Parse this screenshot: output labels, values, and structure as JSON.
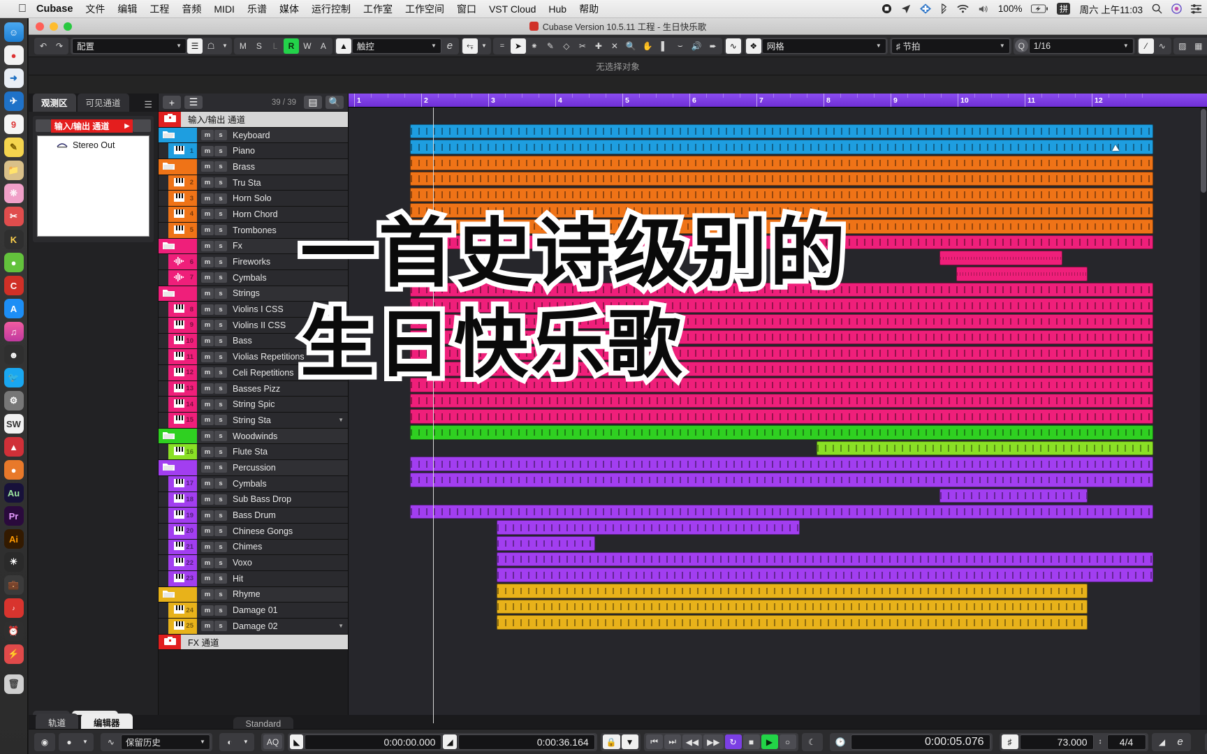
{
  "macbar": {
    "apple_icon": "apple-logo",
    "app": "Cubase",
    "menus": [
      "文件",
      "编辑",
      "工程",
      "音频",
      "MIDI",
      "乐谱",
      "媒体",
      "运行控制",
      "工作室",
      "工作空间",
      "窗口",
      "VST Cloud",
      "Hub",
      "帮助"
    ],
    "status": {
      "record_icon": "screen-record-icon",
      "location_icon": "location-arrow-icon",
      "app_icon": "diamond-app-icon",
      "bluetooth_icon": "bluetooth-icon",
      "wifi_icon": "wifi-icon",
      "volume_icon": "speaker-icon",
      "battery_percent": "100%",
      "battery_icon": "battery-charging-icon",
      "input_source": "拼",
      "clock": "周六 上午11:03",
      "spotlight_icon": "search-icon",
      "siri_icon": "siri-icon",
      "controlcenter_icon": "control-center-icon"
    }
  },
  "window": {
    "title": "Cubase Version 10.5.11 工程 - 生日快乐歌",
    "doc_icon": "cubase-doc-icon"
  },
  "toolbar": {
    "undo_icon": "undo-icon",
    "redo_icon": "redo-icon",
    "config_value": "配置",
    "list_icon": "list-icon",
    "home_icon": "constrain-icon",
    "mute": "M",
    "solo": "S",
    "listen": "L",
    "read": "R",
    "write": "W",
    "auto": "A",
    "autoscroll_icon": "autoscroll-icon",
    "touch_value": "触控",
    "e_icon": "e-icon",
    "snap_align_icon": "snap-align-icon",
    "tools": [
      "equal-icon",
      "arrow-select-icon",
      "range-select-icon",
      "draw-pencil-icon",
      "erase-icon",
      "scissors-icon",
      "glue-icon",
      "mute-x-icon",
      "zoom-magnifier-icon",
      "hand-icon",
      "comp-icon",
      "warp-icon",
      "play-speaker-icon",
      "color-icon"
    ],
    "snap_icon": "snap-magnet-icon",
    "snap_cross_icon": "snap-cross-icon",
    "grid_value": "网格",
    "grid_type_icon": "grid-type-icon",
    "beat_value": "节拍",
    "q_icon": "quantize-icon",
    "quantize_value": "1/16",
    "extra_icons": [
      "percent-icon",
      "waveform-icon",
      "left-zone-icon",
      "lower-zone-icon",
      "right-zone-icon",
      "window-layout-icon",
      "setup-gear-icon"
    ]
  },
  "infobar": {
    "text": "无选择对象"
  },
  "left_zone": {
    "tabs": [
      {
        "label": "观测区",
        "active": true
      },
      {
        "label": "可见通道",
        "active": false
      }
    ],
    "hamburger_icon": "hamburger-icon",
    "io_header": "输入/输出 通道",
    "io_arrow_icon": "chevron-right-icon",
    "io_items": [
      {
        "label": "Stereo Out",
        "icon": "stereo-out-icon"
      }
    ],
    "bottom_tabs": [
      {
        "label": "轨道",
        "active": false
      },
      {
        "label": "编辑器",
        "active": true
      }
    ]
  },
  "track_list": {
    "add_icon": "add-track-icon",
    "filter_icon": "track-filter-icon",
    "count": "39 / 39",
    "list_icon": "list-view-icon",
    "search_icon": "search-icon",
    "footer_preset": "Standard",
    "footer_gear_icon": "gear-icon",
    "mute_label": "m",
    "solo_label": "s",
    "tracks": [
      {
        "name": "输入/输出 通道",
        "type": "io",
        "color": "#e01f1f",
        "num": "",
        "icon": "folder-icon"
      },
      {
        "name": "Keyboard",
        "type": "folder",
        "color": "#1e9ee0",
        "num": "",
        "icon": "folder-icon"
      },
      {
        "name": "Piano",
        "type": "instrument",
        "color": "#1e9ee0",
        "num": "1",
        "icon": "keys-icon"
      },
      {
        "name": "Brass",
        "type": "folder",
        "color": "#ef7317",
        "num": "",
        "icon": "folder-icon"
      },
      {
        "name": "Tru Sta",
        "type": "instrument",
        "color": "#ef7317",
        "num": "2",
        "icon": "keys-icon"
      },
      {
        "name": "Horn Solo",
        "type": "instrument",
        "color": "#ef7317",
        "num": "3",
        "icon": "keys-icon"
      },
      {
        "name": "Horn Chord",
        "type": "instrument",
        "color": "#ef7317",
        "num": "4",
        "icon": "keys-icon"
      },
      {
        "name": "Trombones",
        "type": "instrument",
        "color": "#ef7317",
        "num": "5",
        "icon": "keys-icon"
      },
      {
        "name": "Fx",
        "type": "folder",
        "color": "#ef1f7a",
        "num": "",
        "icon": "folder-icon"
      },
      {
        "name": "Fireworks",
        "type": "audio",
        "color": "#ef1f7a",
        "num": "6",
        "icon": "wave-icon"
      },
      {
        "name": "Cymbals",
        "type": "audio",
        "color": "#ef1f7a",
        "num": "7",
        "icon": "wave-icon"
      },
      {
        "name": "Strings",
        "type": "folder",
        "color": "#ef1f7a",
        "num": "",
        "icon": "folder-icon"
      },
      {
        "name": "Violins I CSS",
        "type": "instrument",
        "color": "#ef1f7a",
        "num": "8",
        "icon": "keys-icon"
      },
      {
        "name": "Violins II CSS",
        "type": "instrument",
        "color": "#ef1f7a",
        "num": "9",
        "icon": "keys-icon"
      },
      {
        "name": "Bass",
        "type": "instrument",
        "color": "#ef1f7a",
        "num": "10",
        "icon": "keys-icon"
      },
      {
        "name": "Violias Repetitions",
        "type": "instrument",
        "color": "#ef1f7a",
        "num": "11",
        "icon": "keys-icon"
      },
      {
        "name": "Celi Repetitions",
        "type": "instrument",
        "color": "#ef1f7a",
        "num": "12",
        "icon": "keys-icon"
      },
      {
        "name": "Basses Pizz",
        "type": "instrument",
        "color": "#ef1f7a",
        "num": "13",
        "icon": "keys-icon"
      },
      {
        "name": "String Spic",
        "type": "instrument",
        "color": "#ef1f7a",
        "num": "14",
        "icon": "keys-icon"
      },
      {
        "name": "String Sta",
        "type": "instrument",
        "color": "#ef1f7a",
        "num": "15",
        "icon": "keys-icon"
      },
      {
        "name": "Woodwinds",
        "type": "folder",
        "color": "#2fd021",
        "num": "",
        "icon": "folder-icon"
      },
      {
        "name": "Flute Sta",
        "type": "instrument",
        "color": "#8ae025",
        "num": "16",
        "icon": "keys-icon"
      },
      {
        "name": "Percussion",
        "type": "folder",
        "color": "#a23ef0",
        "num": "",
        "icon": "folder-icon"
      },
      {
        "name": "Cymbals",
        "type": "instrument",
        "color": "#a23ef0",
        "num": "17",
        "icon": "keys-icon"
      },
      {
        "name": "Sub Bass Drop",
        "type": "instrument",
        "color": "#a23ef0",
        "num": "18",
        "icon": "keys-icon"
      },
      {
        "name": "Bass Drum",
        "type": "instrument",
        "color": "#a23ef0",
        "num": "19",
        "icon": "keys-icon"
      },
      {
        "name": "Chinese Gongs",
        "type": "instrument",
        "color": "#a23ef0",
        "num": "20",
        "icon": "keys-icon"
      },
      {
        "name": "Chimes",
        "type": "instrument",
        "color": "#a23ef0",
        "num": "21",
        "icon": "keys-icon"
      },
      {
        "name": "Voxo",
        "type": "instrument",
        "color": "#a23ef0",
        "num": "22",
        "icon": "keys-icon"
      },
      {
        "name": "Hit",
        "type": "instrument",
        "color": "#a23ef0",
        "num": "23",
        "icon": "keys-icon"
      },
      {
        "name": "Rhyme",
        "type": "folder",
        "color": "#e8b21a",
        "num": "",
        "icon": "folder-icon"
      },
      {
        "name": "Damage 01",
        "type": "instrument",
        "color": "#e8b21a",
        "num": "24",
        "icon": "keys-icon"
      },
      {
        "name": "Damage 02",
        "type": "instrument",
        "color": "#e8b21a",
        "num": "25",
        "icon": "keys-icon"
      },
      {
        "name": "FX 通道",
        "type": "io",
        "color": "#e01f1f",
        "num": "",
        "icon": "folder-icon"
      }
    ]
  },
  "arrange": {
    "ruler_marks": [
      "1",
      "2",
      "3",
      "4",
      "5",
      "6",
      "7",
      "8",
      "9",
      "10",
      "11",
      "12"
    ],
    "playhead_bar": "1.5",
    "clips": [
      {
        "track": 1,
        "color": "#1e9ee0",
        "start": 7.5,
        "end": 98,
        "kind": "midi"
      },
      {
        "track": 2,
        "color": "#1e9ee0",
        "start": 7.5,
        "end": 98,
        "kind": "midi"
      },
      {
        "track": 3,
        "color": "#ef7317",
        "start": 7.5,
        "end": 98,
        "kind": "midi"
      },
      {
        "track": 4,
        "color": "#ef7317",
        "start": 7.5,
        "end": 98,
        "kind": "midi"
      },
      {
        "track": 5,
        "color": "#ef7317",
        "start": 7.5,
        "end": 98,
        "kind": "midi"
      },
      {
        "track": 6,
        "color": "#ef7317",
        "start": 7.5,
        "end": 98,
        "kind": "midi"
      },
      {
        "track": 7,
        "color": "#ef7317",
        "start": 7.5,
        "end": 98,
        "kind": "midi"
      },
      {
        "track": 8,
        "color": "#ef1f7a",
        "start": 7.5,
        "end": 98,
        "kind": "midi"
      },
      {
        "track": 9,
        "color": "#ef1f7a",
        "start": 72,
        "end": 87,
        "kind": "wave"
      },
      {
        "track": 10,
        "color": "#ef1f7a",
        "start": 74,
        "end": 90,
        "kind": "wave"
      },
      {
        "track": 11,
        "color": "#ef1f7a",
        "start": 7.5,
        "end": 98,
        "kind": "midi"
      },
      {
        "track": 12,
        "color": "#ef1f7a",
        "start": 7.5,
        "end": 98,
        "kind": "midi"
      },
      {
        "track": 13,
        "color": "#ef1f7a",
        "start": 7.5,
        "end": 98,
        "kind": "midi"
      },
      {
        "track": 14,
        "color": "#ef1f7a",
        "start": 7.5,
        "end": 98,
        "kind": "midi"
      },
      {
        "track": 15,
        "color": "#ef1f7a",
        "start": 7.5,
        "end": 98,
        "kind": "midi"
      },
      {
        "track": 16,
        "color": "#ef1f7a",
        "start": 7.5,
        "end": 98,
        "kind": "midi"
      },
      {
        "track": 17,
        "color": "#ef1f7a",
        "start": 7.5,
        "end": 98,
        "kind": "midi"
      },
      {
        "track": 18,
        "color": "#ef1f7a",
        "start": 7.5,
        "end": 98,
        "kind": "midi"
      },
      {
        "track": 19,
        "color": "#ef1f7a",
        "start": 7.5,
        "end": 98,
        "kind": "midi"
      },
      {
        "track": 20,
        "color": "#2fd021",
        "start": 7.5,
        "end": 98,
        "kind": "midi"
      },
      {
        "track": 21,
        "color": "#8ae025",
        "start": 57,
        "end": 98,
        "kind": "midi"
      },
      {
        "track": 22,
        "color": "#a23ef0",
        "start": 7.5,
        "end": 98,
        "kind": "midi"
      },
      {
        "track": 23,
        "color": "#a23ef0",
        "start": 7.5,
        "end": 98,
        "kind": "midi"
      },
      {
        "track": 24,
        "color": "#a23ef0",
        "start": 72,
        "end": 90,
        "kind": "midi"
      },
      {
        "track": 25,
        "color": "#a23ef0",
        "start": 7.5,
        "end": 98,
        "kind": "midi"
      },
      {
        "track": 26,
        "color": "#a23ef0",
        "start": 18,
        "end": 55,
        "kind": "midi"
      },
      {
        "track": 27,
        "color": "#a23ef0",
        "start": 18,
        "end": 30,
        "kind": "midi"
      },
      {
        "track": 28,
        "color": "#a23ef0",
        "start": 18,
        "end": 98,
        "kind": "midi"
      },
      {
        "track": 29,
        "color": "#a23ef0",
        "start": 18,
        "end": 98,
        "kind": "midi"
      },
      {
        "track": 30,
        "color": "#e8b21a",
        "start": 18,
        "end": 90,
        "kind": "midi"
      },
      {
        "track": 31,
        "color": "#e8b21a",
        "start": 18,
        "end": 90,
        "kind": "midi"
      },
      {
        "track": 32,
        "color": "#e8b21a",
        "start": 18,
        "end": 90,
        "kind": "midi"
      }
    ]
  },
  "overlay_caption": {
    "line1": "一首史诗级别的",
    "line2": "生日快乐歌"
  },
  "transport": {
    "cycle_icon": "metronome-cycle-icon",
    "rec_mode_icon": "record-dot-icon",
    "history_icon": "waveform-icon",
    "history_value": "保留历史",
    "palette_icon": "palette-icon",
    "aq_label": "AQ",
    "left_locator_icon": "left-locator-icon",
    "left_locator": "0:00:00.000",
    "right_locator_icon": "right-locator-icon",
    "right_locator": "0:00:36.164",
    "lock_icon": "lock-icon",
    "punch_icon": "punch-icon",
    "go_start_icon": "skip-start-icon",
    "go_end_icon": "skip-end-icon",
    "rewind_icon": "rewind-icon",
    "forward_icon": "forward-icon",
    "cycle_loop_icon": "loop-icon",
    "stop_icon": "stop-icon",
    "play_icon": "play-icon",
    "record_icon": "record-icon",
    "metronome_icon": "metronome-icon",
    "time_icon": "clock-icon",
    "primary_time": "0:00:05.076",
    "tempo_icon": "tempo-note-icon",
    "tempo_value": "73.000",
    "tempo_spinner_icon": "spinner-icon",
    "time_signature": "4/4",
    "tempo_track_icon": "tempo-track-icon",
    "tempo_e_icon": "e-icon",
    "meter_icon": "level-meter-icon",
    "setup_icon": "gear-icon"
  },
  "colors": {
    "accent_purple": "#7b3fe4",
    "rec_red": "#e01f1f",
    "play_green": "#22d447",
    "keyboard_blue": "#1e9ee0",
    "brass_orange": "#ef7317",
    "strings_pink": "#ef1f7a",
    "wood_green": "#2fd021",
    "perc_purple": "#a23ef0",
    "rhyme_yellow": "#e8b21a"
  }
}
